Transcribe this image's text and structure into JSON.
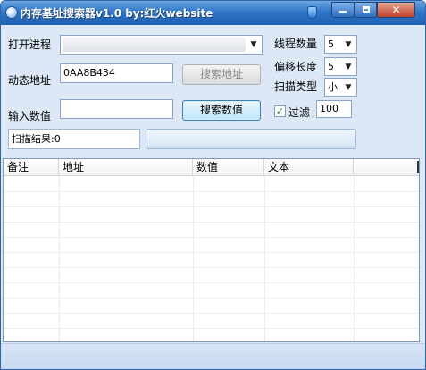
{
  "window": {
    "title": "内存基址搜索器v1.0  by:红火website"
  },
  "form": {
    "open_process_label": "打开进程",
    "dynamic_address_label": "动态地址",
    "dynamic_address_value": "0AA8B434",
    "search_address_button": "搜索地址",
    "input_value_label": "输入数值",
    "input_value_value": "",
    "search_value_button": "搜索数值",
    "thread_count_label": "线程数量",
    "thread_count_value": "5",
    "offset_length_label": "偏移长度",
    "offset_length_value": "5",
    "scan_type_label": "扫描类型",
    "scan_type_value": "小",
    "filter_label": "过滤",
    "filter_checked": true,
    "filter_value": "100",
    "scan_result_text": "扫描结果:0"
  },
  "table": {
    "columns": [
      "备注",
      "地址",
      "数值",
      "文本"
    ],
    "rows": []
  },
  "colors": {
    "title_bar": "#2f77c8",
    "client_bg": "#dce8f6",
    "close_button": "#c0422a",
    "active_button": "#bee6fd"
  }
}
